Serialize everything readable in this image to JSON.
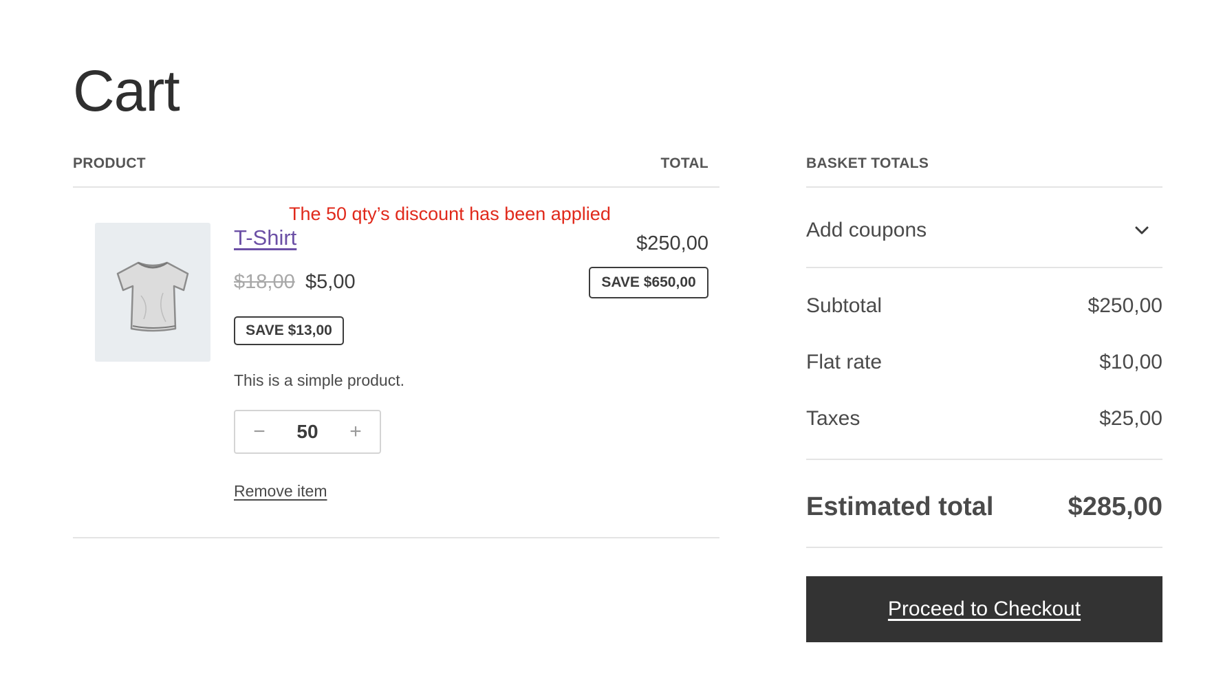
{
  "page": {
    "title": "Cart"
  },
  "cart": {
    "headers": {
      "product": "PRODUCT",
      "total": "TOTAL"
    },
    "notice": "The 50 qty’s discount has been applied",
    "item": {
      "name": "T-Shirt",
      "regular_price": "$18,00",
      "sale_price": "$5,00",
      "save_badge": "SAVE $13,00",
      "description": "This is a simple product.",
      "quantity": "50",
      "decrease_symbol": "−",
      "increase_symbol": "+",
      "remove_label": "Remove item",
      "line_total": "$250,00",
      "line_save_badge": "SAVE $650,00",
      "image_icon": "tshirt-icon"
    }
  },
  "totals": {
    "header": "BASKET TOTALS",
    "coupons_label": "Add coupons",
    "coupons_icon": "chevron-down-icon",
    "rows": [
      {
        "label": "Subtotal",
        "value": "$250,00"
      },
      {
        "label": "Flat rate",
        "value": "$10,00"
      },
      {
        "label": "Taxes",
        "value": "$25,00"
      }
    ],
    "estimated_label": "Estimated total",
    "estimated_value": "$285,00",
    "checkout_label": "Proceed to Checkout"
  },
  "colors": {
    "notice": "#e0291b",
    "product_link": "#6b4fa5",
    "checkout_bg": "#333333"
  }
}
